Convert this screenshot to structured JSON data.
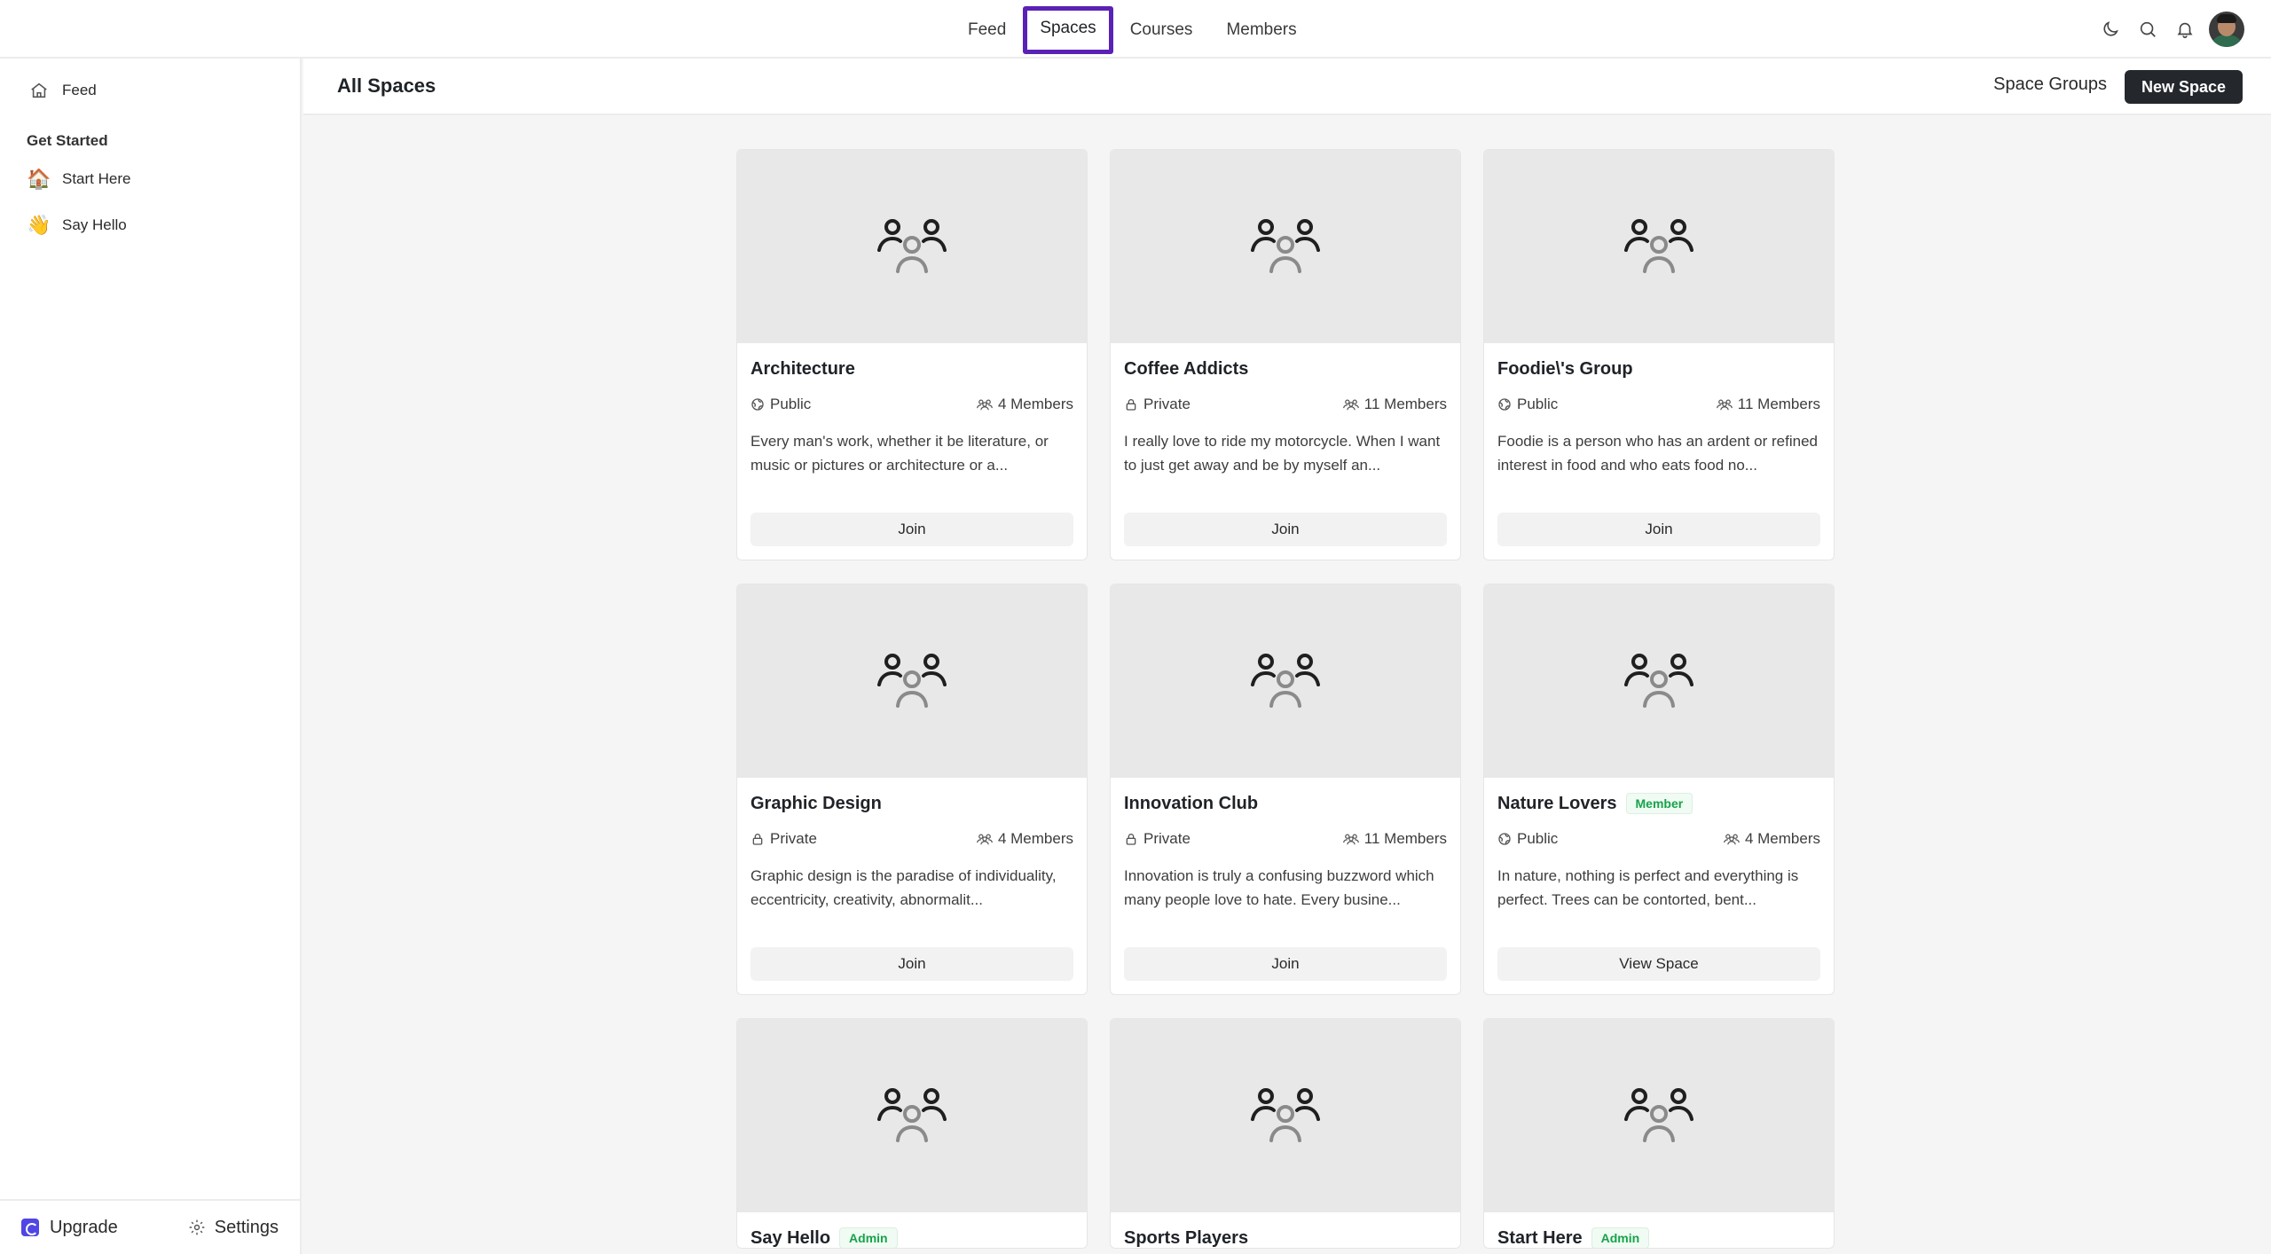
{
  "nav": {
    "links": [
      "Feed",
      "Spaces",
      "Courses",
      "Members"
    ],
    "active": "Spaces",
    "icons": [
      "moon-icon",
      "search-icon",
      "bell-icon",
      "user-avatar"
    ]
  },
  "sidebar": {
    "feed_label": "Feed",
    "section_title": "Get Started",
    "items": [
      {
        "icon": "🏠",
        "label": "Start Here"
      },
      {
        "icon": "👋",
        "label": "Say Hello"
      }
    ],
    "upgrade_label": "Upgrade",
    "settings_label": "Settings"
  },
  "header": {
    "title": "All Spaces",
    "space_groups_label": "Space Groups",
    "new_space_label": "New Space"
  },
  "spaces": [
    {
      "name": "Architecture",
      "badge": "",
      "privacy": "Public",
      "members": "4 Members",
      "desc": "Every man's work, whether it be literature, or music or pictures or architecture or a...",
      "action": "Join"
    },
    {
      "name": "Coffee Addicts",
      "badge": "",
      "privacy": "Private",
      "members": "11 Members",
      "desc": "I really love to ride my motorcycle. When I want to just get away and be by myself an...",
      "action": "Join"
    },
    {
      "name": "Foodie\\'s Group",
      "badge": "",
      "privacy": "Public",
      "members": "11 Members",
      "desc": "Foodie is a person who has an ardent or refined interest in food and who eats food no...",
      "action": "Join"
    },
    {
      "name": "Graphic Design",
      "badge": "",
      "privacy": "Private",
      "members": "4 Members",
      "desc": "Graphic design is the paradise of individuality, eccentricity, creativity, abnormalit...",
      "action": "Join"
    },
    {
      "name": "Innovation Club",
      "badge": "",
      "privacy": "Private",
      "members": "11 Members",
      "desc": "Innovation is truly a confusing buzzword which many people love to hate. Every busine...",
      "action": "Join"
    },
    {
      "name": "Nature Lovers",
      "badge": "Member",
      "privacy": "Public",
      "members": "4 Members",
      "desc": "In nature, nothing is perfect and everything is perfect. Trees can be contorted, bent...",
      "action": "View Space"
    },
    {
      "name": "Say Hello",
      "badge": "Admin"
    },
    {
      "name": "Sports Players",
      "badge": ""
    },
    {
      "name": "Start Here",
      "badge": "Admin"
    }
  ]
}
